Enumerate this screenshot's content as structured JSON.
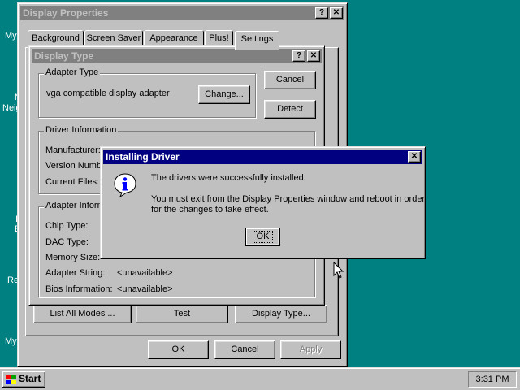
{
  "desktop": {
    "labels": [
      "My",
      "N",
      "Neig",
      "I",
      "E",
      "Re",
      "My"
    ]
  },
  "display_properties": {
    "title": "Display Properties",
    "help_btn": "?",
    "close_btn": "✕",
    "tabs": [
      "Background",
      "Screen Saver",
      "Appearance",
      "Plus!",
      "Settings"
    ],
    "buttons": {
      "list_all_modes": "List All Modes ...",
      "test": "Test",
      "display_type": "Display Type...",
      "ok": "OK",
      "cancel": "Cancel",
      "apply": "Apply"
    }
  },
  "display_type": {
    "title": "Display Type",
    "help_btn": "?",
    "close_btn": "✕",
    "adapter_type": {
      "label": "Adapter Type",
      "value": "vga compatible display adapter",
      "change_button": "Change..."
    },
    "cancel_button": "Cancel",
    "detect_button": "Detect",
    "driver_info": {
      "label": "Driver Information",
      "manufacturer": "Manufacturer:",
      "version": "Version Numbe",
      "files": "Current Files:"
    },
    "adapter_info": {
      "label": "Adapter Inform",
      "chip_type": "Chip Type:",
      "dac_type": "DAC Type:",
      "memory_size": "Memory Size:",
      "adapter_string": "Adapter String:",
      "adapter_string_value": "<unavailable>",
      "bios_info": "Bios Information:",
      "bios_info_value": "<unavailable>"
    }
  },
  "installing_driver": {
    "title": "Installing Driver",
    "close_btn": "✕",
    "icon": "information-icon",
    "message1": "The drivers were successfully installed.",
    "message2_line1": "You must exit from the Display Properties window and reboot in order",
    "message2_line2": "for the changes to take effect.",
    "ok_button": "OK"
  },
  "taskbar": {
    "start_label": "Start",
    "clock": "3:31 PM"
  }
}
